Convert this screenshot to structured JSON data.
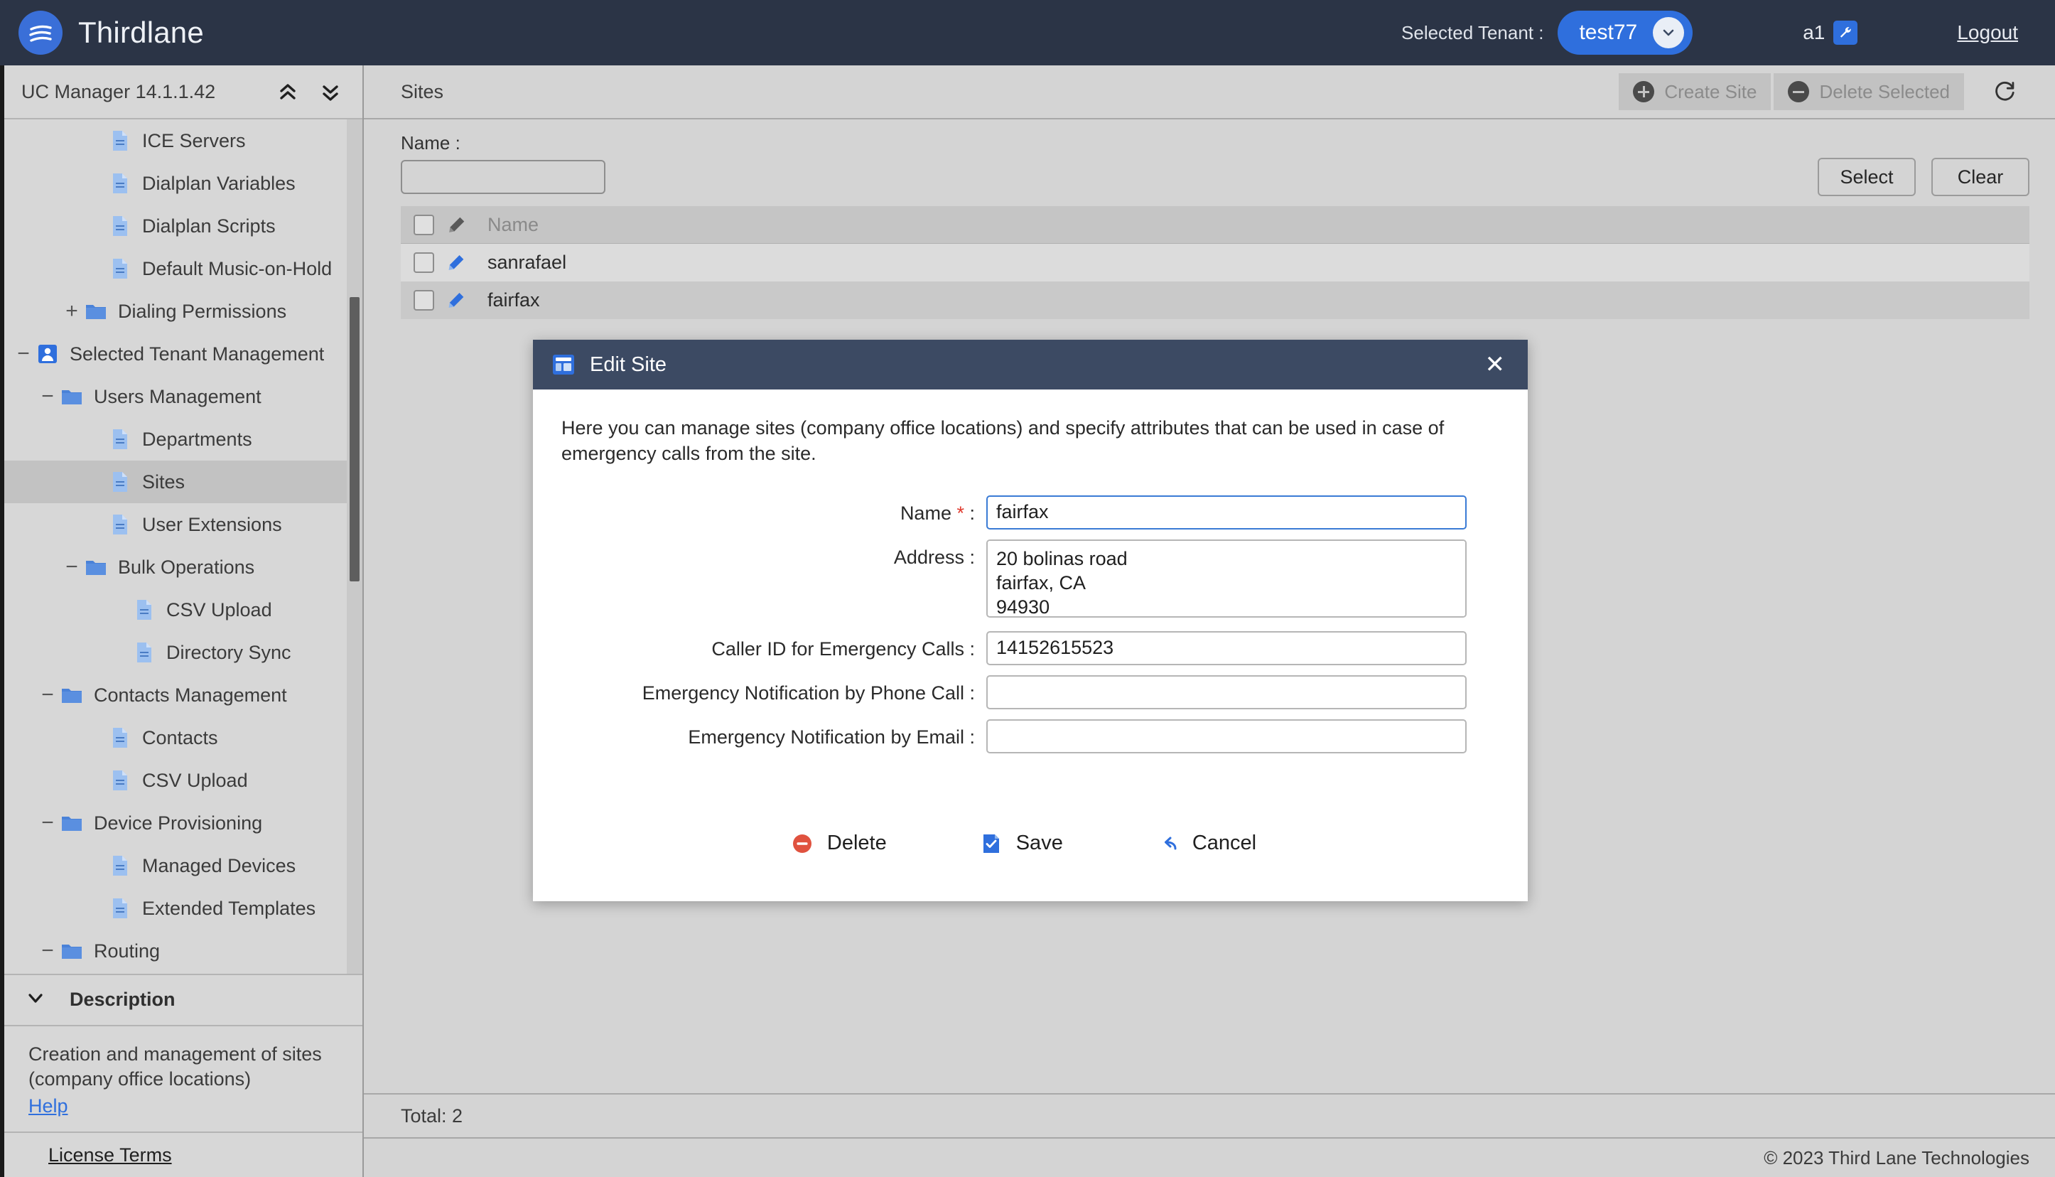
{
  "topbar": {
    "brand": "Thirdlane",
    "logo_icon": "thirdlane-logo-icon",
    "tenant_label": "Selected Tenant :",
    "tenant_value": "test77",
    "tenant_chevron_icon": "chevron-down-icon",
    "user_name": "a1",
    "user_badge_icon": "wrench-icon",
    "logout": "Logout",
    "bg_color": "#2b3446",
    "accent_color": "#2f6fdd"
  },
  "sidebar": {
    "header_title": "UC Manager 14.1.1.42",
    "collapse_all_icon": "double-chevron-up-icon",
    "expand_all_icon": "double-chevron-down-icon",
    "tree": [
      {
        "label": "ICE Servers",
        "icon": "document-icon",
        "indent": 3,
        "twisty": "",
        "selected": false
      },
      {
        "label": "Dialplan Variables",
        "icon": "document-icon",
        "indent": 3,
        "twisty": "",
        "selected": false
      },
      {
        "label": "Dialplan Scripts",
        "icon": "document-icon",
        "indent": 3,
        "twisty": "",
        "selected": false
      },
      {
        "label": "Default Music-on-Hold",
        "icon": "document-icon",
        "indent": 3,
        "twisty": "",
        "selected": false
      },
      {
        "label": "Dialing Permissions",
        "icon": "folder-icon",
        "indent": 2,
        "twisty": "+",
        "selected": false
      },
      {
        "label": "Selected Tenant Management",
        "icon": "user-badge-icon",
        "indent": 0,
        "twisty": "-",
        "selected": false
      },
      {
        "label": "Users Management",
        "icon": "folder-icon",
        "indent": 1,
        "twisty": "-",
        "selected": false
      },
      {
        "label": "Departments",
        "icon": "document-icon",
        "indent": 3,
        "twisty": "",
        "selected": false
      },
      {
        "label": "Sites",
        "icon": "document-icon",
        "indent": 3,
        "twisty": "",
        "selected": true
      },
      {
        "label": "User Extensions",
        "icon": "document-icon",
        "indent": 3,
        "twisty": "",
        "selected": false
      },
      {
        "label": "Bulk Operations",
        "icon": "folder-icon",
        "indent": 2,
        "twisty": "-",
        "selected": false
      },
      {
        "label": "CSV Upload",
        "icon": "document-icon",
        "indent": 4,
        "twisty": "",
        "selected": false
      },
      {
        "label": "Directory Sync",
        "icon": "document-icon",
        "indent": 4,
        "twisty": "",
        "selected": false
      },
      {
        "label": "Contacts Management",
        "icon": "folder-icon",
        "indent": 1,
        "twisty": "-",
        "selected": false
      },
      {
        "label": "Contacts",
        "icon": "document-icon",
        "indent": 3,
        "twisty": "",
        "selected": false
      },
      {
        "label": "CSV Upload",
        "icon": "document-icon",
        "indent": 3,
        "twisty": "",
        "selected": false
      },
      {
        "label": "Device Provisioning",
        "icon": "folder-icon",
        "indent": 1,
        "twisty": "-",
        "selected": false
      },
      {
        "label": "Managed Devices",
        "icon": "document-icon",
        "indent": 3,
        "twisty": "",
        "selected": false
      },
      {
        "label": "Extended Templates",
        "icon": "document-icon",
        "indent": 3,
        "twisty": "",
        "selected": false
      },
      {
        "label": "Routing",
        "icon": "folder-icon",
        "indent": 1,
        "twisty": "-",
        "selected": false
      }
    ],
    "description": {
      "header": "Description",
      "chevron_icon": "chevron-down-icon",
      "text": "Creation and management of sites (company office locations)",
      "help_link": "Help"
    },
    "license_link": "License Terms"
  },
  "main": {
    "page_title": "Sites",
    "toolbar": {
      "create_label": "Create Site",
      "create_icon": "plus-circle-icon",
      "delete_label": "Delete Selected",
      "delete_icon": "minus-circle-icon",
      "refresh_icon": "refresh-icon"
    },
    "filter": {
      "label": "Name :",
      "value": "",
      "placeholder": "",
      "select_label": "Select",
      "clear_label": "Clear"
    },
    "table": {
      "columns": [
        "Name"
      ],
      "header_edit_icon": "pencil-icon",
      "header_checkbox_icon": "checkbox-icon",
      "rows": [
        {
          "name": "sanrafael",
          "edit_icon": "pencil-icon",
          "checked": false
        },
        {
          "name": "fairfax",
          "edit_icon": "pencil-icon",
          "checked": false
        }
      ]
    },
    "total_text": "Total: 2",
    "copyright": "© 2023 Third Lane Technologies"
  },
  "modal": {
    "icon": "window-panel-icon",
    "title": "Edit Site",
    "close_icon": "close-icon",
    "description": "Here you can manage sites (company office locations) and specify attributes that can be used in case of emergency calls from the site.",
    "fields": [
      {
        "label": "Name",
        "required": true,
        "value": "fairfax",
        "type": "text",
        "focused": true
      },
      {
        "label": "Address",
        "required": false,
        "value": "20 bolinas road\nfairfax, CA\n94930",
        "type": "textarea",
        "focused": false
      },
      {
        "label": "Caller ID for Emergency Calls",
        "required": false,
        "value": "14152615523",
        "type": "text",
        "focused": false
      },
      {
        "label": "Emergency Notification by Phone Call",
        "required": false,
        "value": "",
        "type": "text",
        "focused": false
      },
      {
        "label": "Emergency Notification by Email",
        "required": false,
        "value": "",
        "type": "text",
        "focused": false
      }
    ],
    "actions": [
      {
        "label": "Delete",
        "icon": "delete-circle-icon"
      },
      {
        "label": "Save",
        "icon": "save-check-icon"
      },
      {
        "label": "Cancel",
        "icon": "undo-arrow-icon"
      }
    ],
    "header_bg": "#3c4a63"
  }
}
